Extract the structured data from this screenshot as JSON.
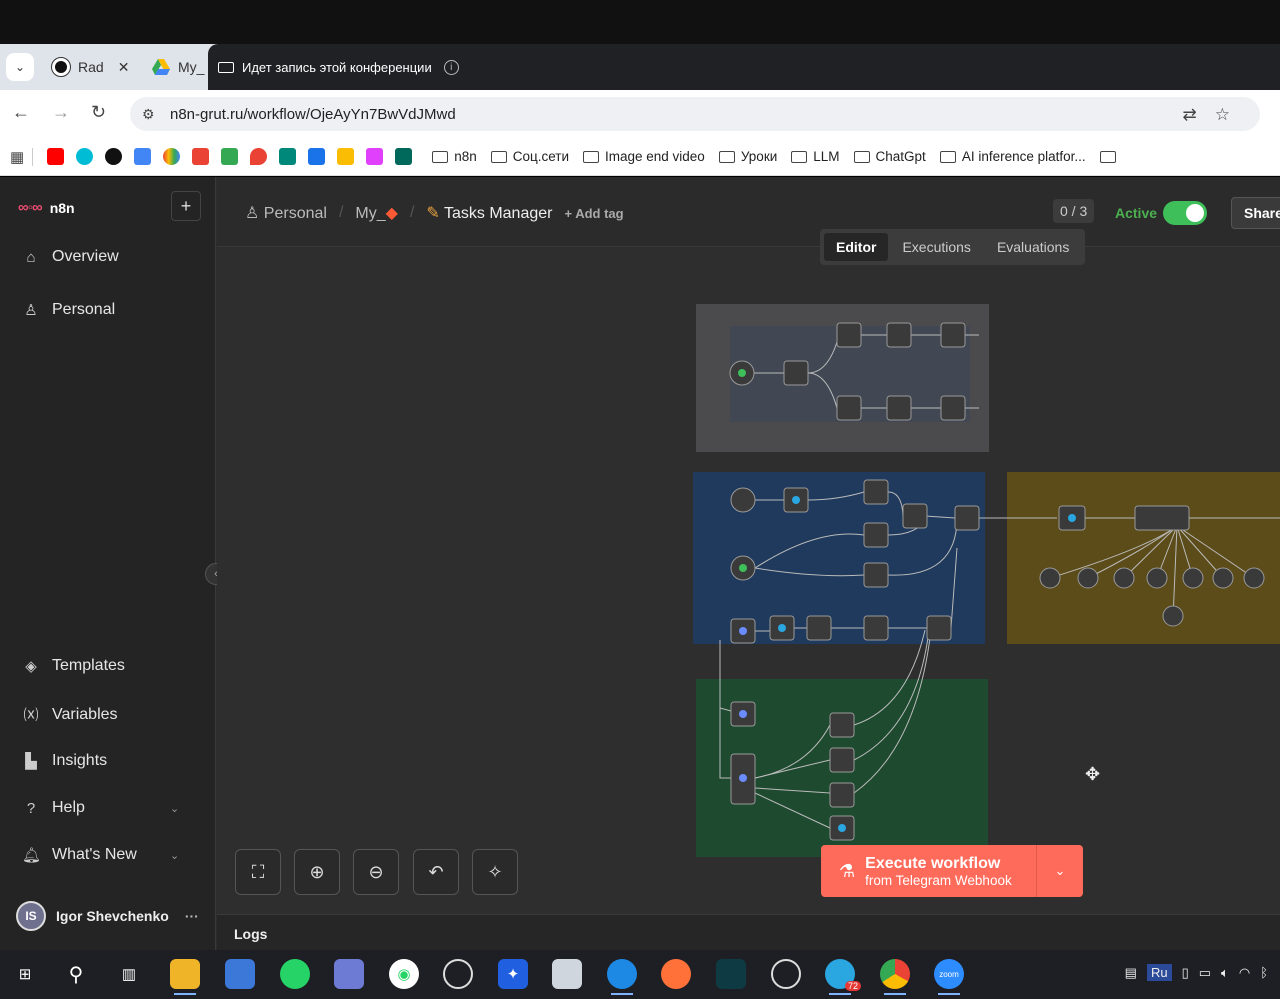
{
  "browser": {
    "tabs": [
      {
        "label": "Rad",
        "close": "✕"
      },
      {
        "label": "My_"
      }
    ],
    "recording_text": "Идет запись этой конференции",
    "url": "n8n-grut.ru/workflow/OjeAyYn7BwVdJMwd",
    "bookmark_folders": [
      "n8n",
      "Соц.сети",
      "Image end video",
      "Уроки",
      "LLM",
      "ChatGpt",
      "AI inference platfor..."
    ]
  },
  "app": {
    "logo_text": "n8n",
    "add_label": "+",
    "sidebar": {
      "top_items": [
        {
          "label": "Overview",
          "icon": "home-icon"
        },
        {
          "label": "Personal",
          "icon": "user-icon"
        }
      ],
      "bottom_items": [
        {
          "label": "Templates",
          "icon": "box-icon"
        },
        {
          "label": "Variables",
          "icon": "variable-icon"
        },
        {
          "label": "Insights",
          "icon": "chart-icon"
        },
        {
          "label": "Help",
          "icon": "help-icon"
        },
        {
          "label": "What's New",
          "icon": "bell-icon"
        }
      ],
      "user_initials": "IS",
      "user_name": "Igor Shevchenko",
      "user_more": "···"
    },
    "header": {
      "crumb_project": "Personal",
      "crumb_folder": "My_",
      "workflow_title": "Tasks Manager",
      "add_tag": "+ Add tag",
      "counter": "0 / 3",
      "active_label": "Active",
      "share_label": "Share",
      "mode_tabs": [
        "Editor",
        "Executions",
        "Evaluations"
      ]
    },
    "execute": {
      "line1": "Execute workflow",
      "line2": "from Telegram Webhook"
    },
    "logs_label": "Logs",
    "colors": {
      "accent": "#ff6b5b",
      "active_green": "#3fbf5a",
      "sticky_gray": "#4b4b4d",
      "sticky_blue": "#1f3a5c",
      "sticky_olive": "#5c4c1a",
      "sticky_green": "#1e4a30"
    }
  },
  "taskbar": {
    "lang": "Ru",
    "telegram_badge": "72"
  }
}
